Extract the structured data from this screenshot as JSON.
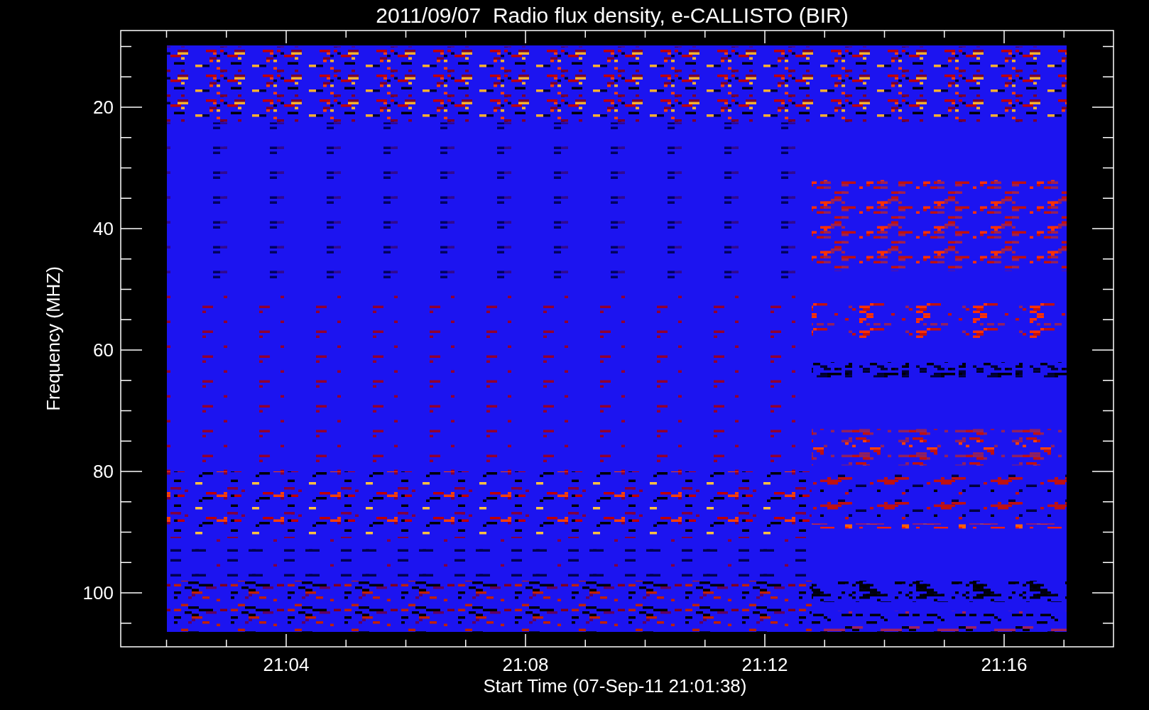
{
  "title": "2011/09/07  Radio flux density, e-CALLISTO (BIR)",
  "y_axis": {
    "label": "Frequency (MHZ)",
    "ticks": [
      "20",
      "40",
      "60",
      "80",
      "100"
    ]
  },
  "x_axis": {
    "label": "Start Time (07-Sep-11 21:01:38)",
    "ticks": [
      "21:04",
      "21:08",
      "21:12",
      "21:16"
    ]
  }
}
